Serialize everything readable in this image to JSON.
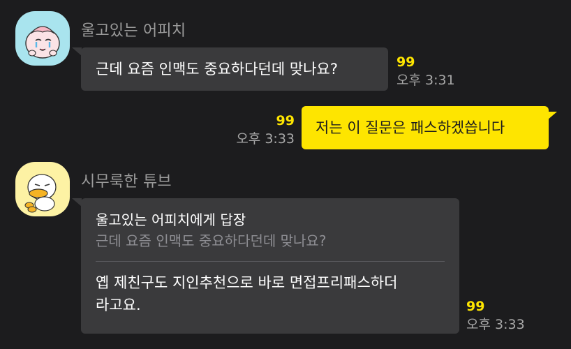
{
  "messages": [
    {
      "sender": "울고있는 어피치",
      "text": "근데 요즘 인맥도 중요하다던데 맞나요?",
      "unread": "99",
      "time": "오후 3:31"
    },
    {
      "text": "저는 이 질문은 패스하겠씁니다",
      "unread": "99",
      "time": "오후 3:33"
    },
    {
      "sender": "시무룩한 튜브",
      "reply_to": "울고있는 어피치에게 답장",
      "quoted": "근데 요즘 인맥도 중요하다던데 맞나요?",
      "text_line1": "옙 제친구도 지인추천으로 바로 면접프리패스하더",
      "text_line2": "라고요.",
      "unread": "99",
      "time": "오후 3:33"
    }
  ],
  "colors": {
    "background": "#1c1c1e",
    "bubble_dark": "#3a3a3c",
    "bubble_mine": "#fee500",
    "unread": "#fee500"
  },
  "icons": {
    "avatar1": "apeach-crying-avatar",
    "avatar2": "tube-duck-avatar"
  }
}
